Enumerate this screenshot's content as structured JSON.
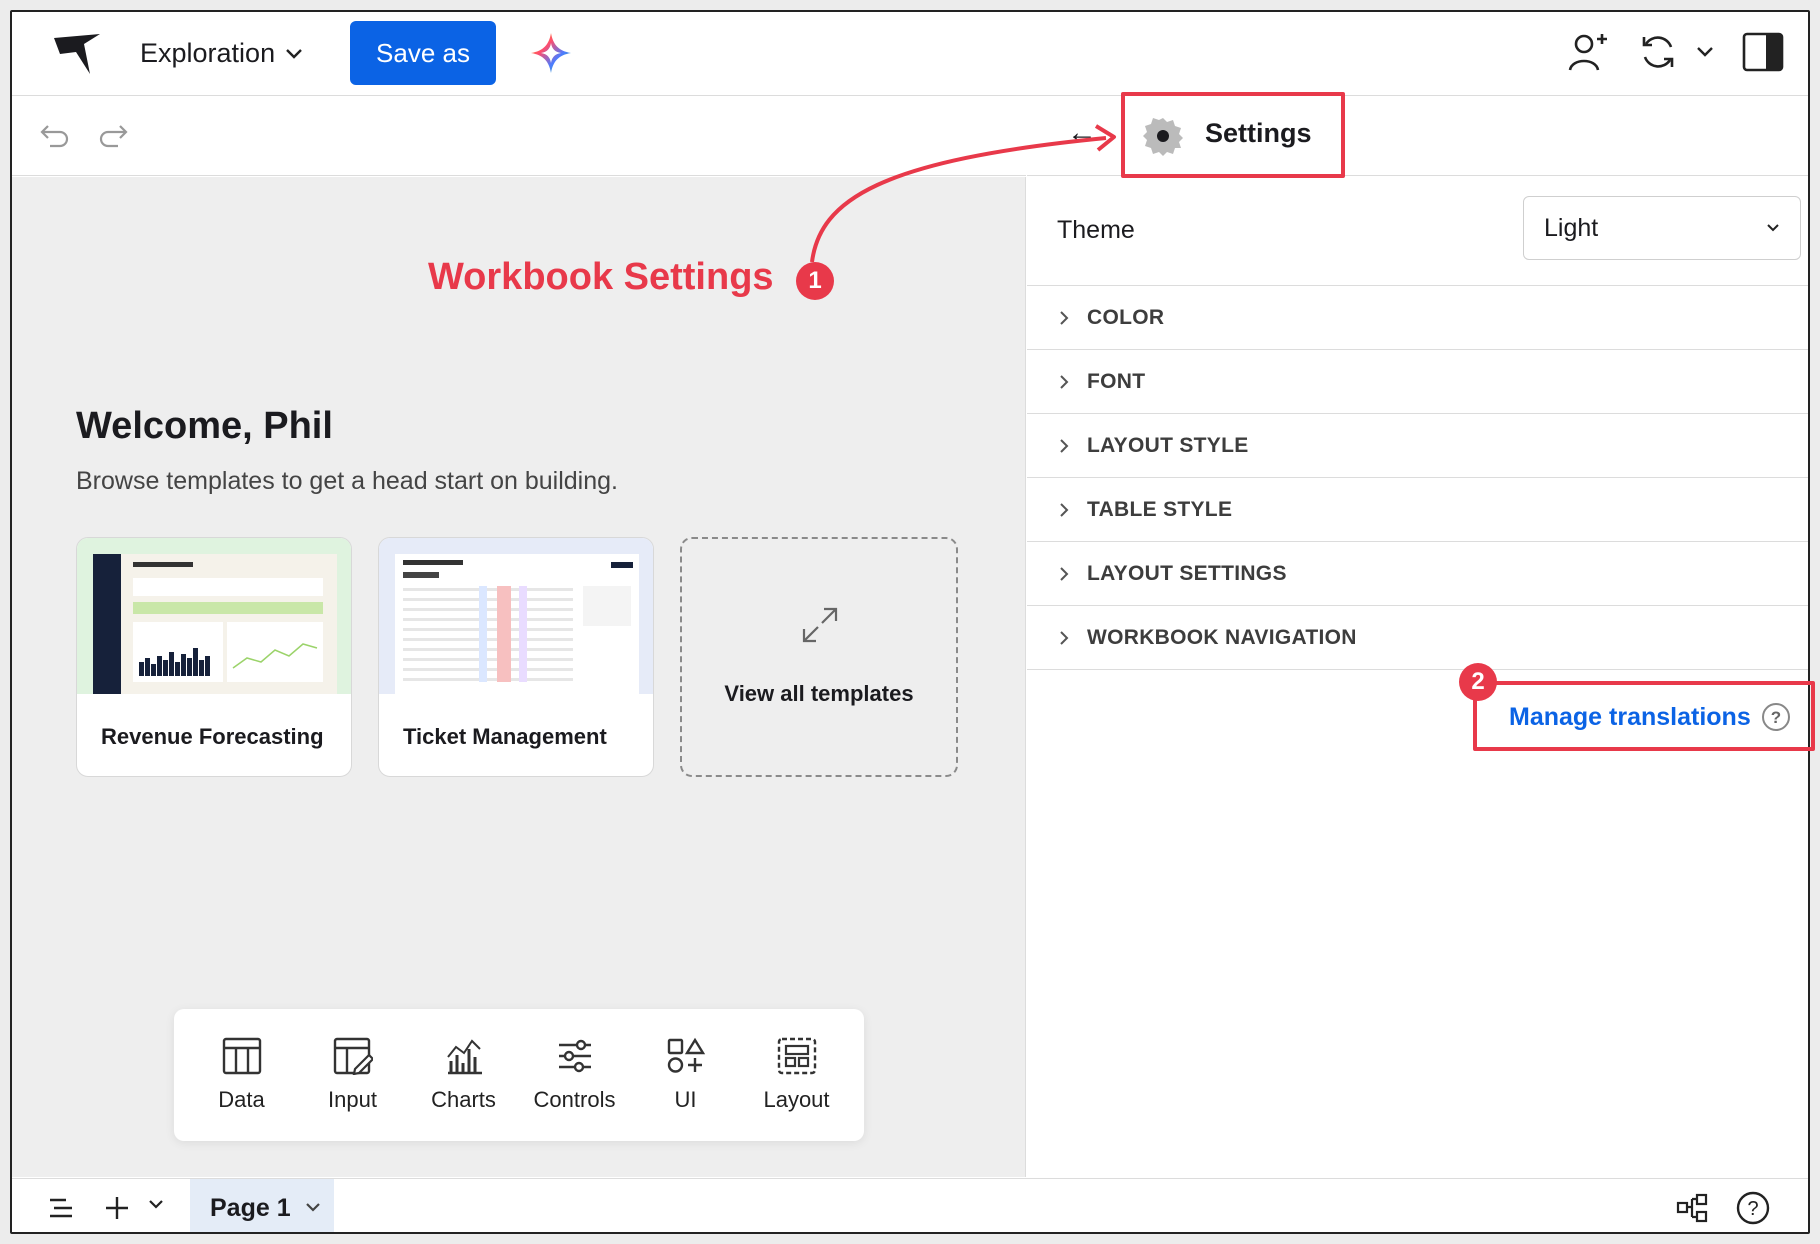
{
  "header": {
    "doc_title": "Exploration",
    "save_label": "Save as"
  },
  "welcome": {
    "title": "Welcome, Phil",
    "subtitle": "Browse templates to get a head start on building.",
    "templates": [
      {
        "label": "Revenue Forecasting"
      },
      {
        "label": "Ticket Management"
      }
    ],
    "view_all_label": "View all templates"
  },
  "element_bar": {
    "items": [
      {
        "label": "Data",
        "icon": "table-icon"
      },
      {
        "label": "Input",
        "icon": "input-icon"
      },
      {
        "label": "Charts",
        "icon": "charts-icon"
      },
      {
        "label": "Controls",
        "icon": "controls-icon"
      },
      {
        "label": "UI",
        "icon": "ui-icon"
      },
      {
        "label": "Layout",
        "icon": "layout-icon"
      }
    ]
  },
  "bottombar": {
    "page_tab": "Page 1"
  },
  "panel": {
    "title": "Settings",
    "theme_label": "Theme",
    "theme_value": "Light",
    "sections": [
      "COLOR",
      "FONT",
      "LAYOUT STYLE",
      "TABLE STYLE",
      "LAYOUT SETTINGS",
      "WORKBOOK NAVIGATION"
    ],
    "manage_translations": "Manage translations"
  },
  "annotations": {
    "label_1": "Workbook Settings",
    "badge_1": "1",
    "badge_2": "2",
    "color": "#e8394a"
  },
  "colors": {
    "accent": "#0b63e5",
    "page_tab_bg": "#e4ecf7"
  }
}
